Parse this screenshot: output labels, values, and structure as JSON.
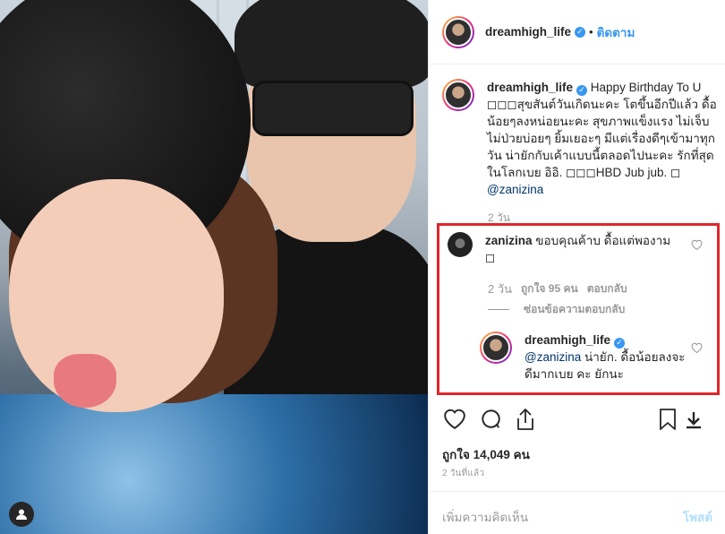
{
  "header": {
    "username": "dreamhigh_life",
    "separator": "•",
    "follow_label": "ติดตาม"
  },
  "caption": {
    "username": "dreamhigh_life",
    "text": "Happy Birthday To U ◻◻◻สุขสันต์วันเกิดนะคะ โตขึ้นอีกปีแล้ว ดื้อน้อยๆลงหน่อยนะคะ สุขภาพแข็งแรง ไม่เจ็บไม่ป่วยบ่อยๆ ยิ้มเยอะๆ มีแต่เรื่องดีๆเข้ามาทุกวัน น่ายักกับเค้าแบบนี้ตลอดไปนะคะ รักที่สุดในโลกเบย อิอิ. ◻◻◻HBD Jub jub. ◻ ",
    "mention": "@zanizina",
    "time": "2 วัน"
  },
  "comments": [
    {
      "username": "zanizina",
      "text": "ขอบคุณค้าบ ดื้อแต่พองาม ◻",
      "time": "2 วัน",
      "likes": "ถูกใจ 95 คน",
      "reply_label": "ตอบกลับ"
    }
  ],
  "hide_replies_label": "ซ่อนข้อความตอบกลับ",
  "reply": {
    "username": "dreamhigh_life",
    "mention": "@zanizina",
    "text": " น่ายัก. ดื้อน้อยลงจะดีมากเบย คะ ยักนะ"
  },
  "likes_count": "ถูกใจ 14,049 คน",
  "posted_ago": "2 วันที่แล้ว",
  "add_comment_placeholder": "เพิ่มความคิดเห็น",
  "post_label": "โพสต์",
  "icons": [
    "heart-icon",
    "comment-icon",
    "share-icon",
    "bookmark-icon",
    "download-icon",
    "verified-icon",
    "user-tag-icon"
  ],
  "colors": {
    "link": "#3897f0",
    "mention": "#003569",
    "highlight": "#e0262a",
    "muted": "#999999"
  }
}
